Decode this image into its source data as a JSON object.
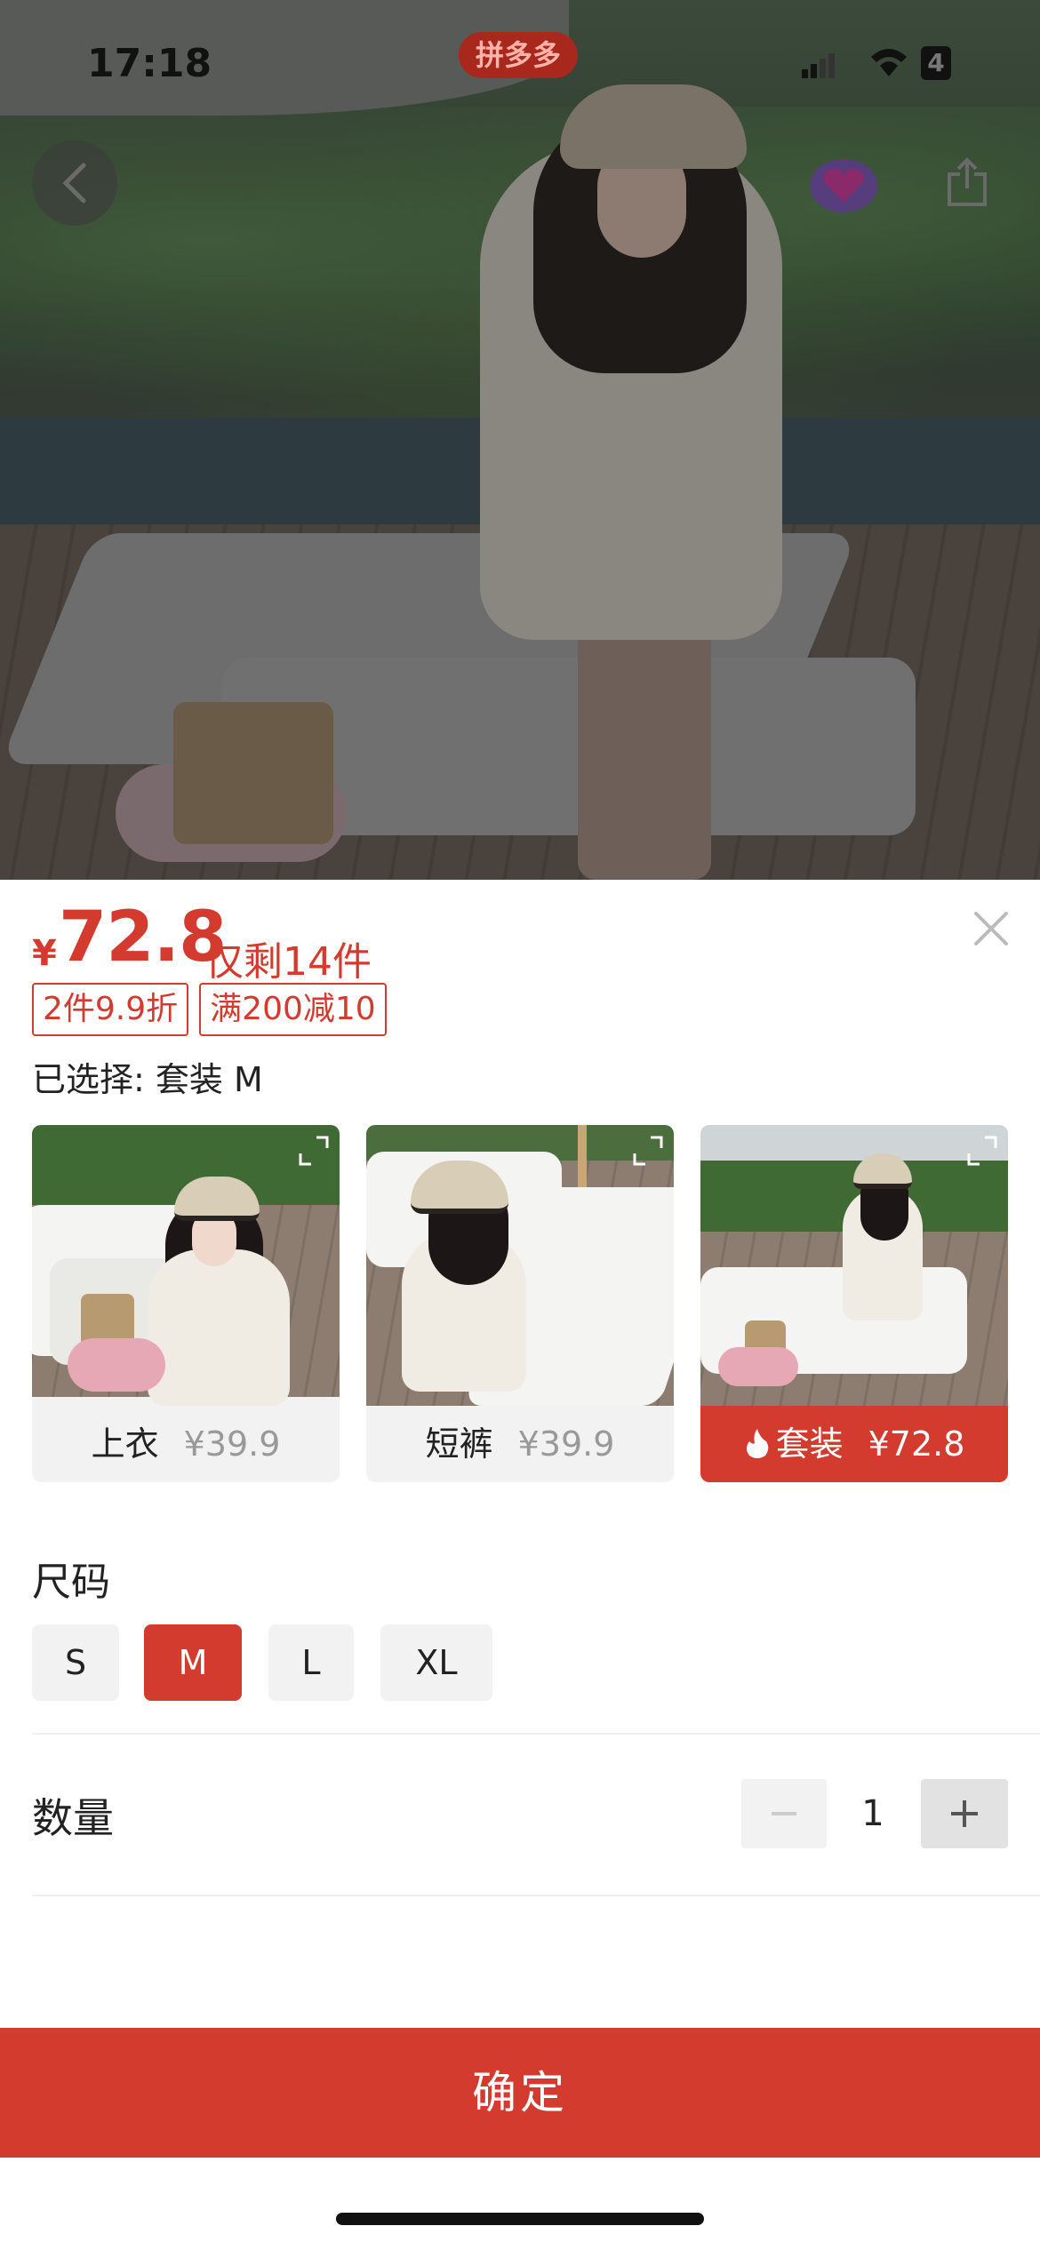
{
  "status_bar": {
    "time": "17:18",
    "battery": "4"
  },
  "app_badge": "拼多多",
  "product": {
    "currency": "¥",
    "price": "72.8",
    "stock": "仅剩14件",
    "promo_tags": [
      "2件9.9折",
      "满200减10"
    ],
    "selected": "已选择: 套装 M"
  },
  "variants": [
    {
      "name": "上衣",
      "price": "¥39.9",
      "selected": false
    },
    {
      "name": "短裤",
      "price": "¥39.9",
      "selected": false
    },
    {
      "name": "套装",
      "price": "¥72.8",
      "selected": true,
      "icon": "flame-icon"
    }
  ],
  "size": {
    "heading": "尺码",
    "options": [
      "S",
      "M",
      "L",
      "XL"
    ],
    "selected": "M"
  },
  "quantity": {
    "label": "数量",
    "value": "1"
  },
  "confirm_label": "确定",
  "colors": {
    "accent": "#d23b2e",
    "chip_bg": "#f2f2f2"
  }
}
